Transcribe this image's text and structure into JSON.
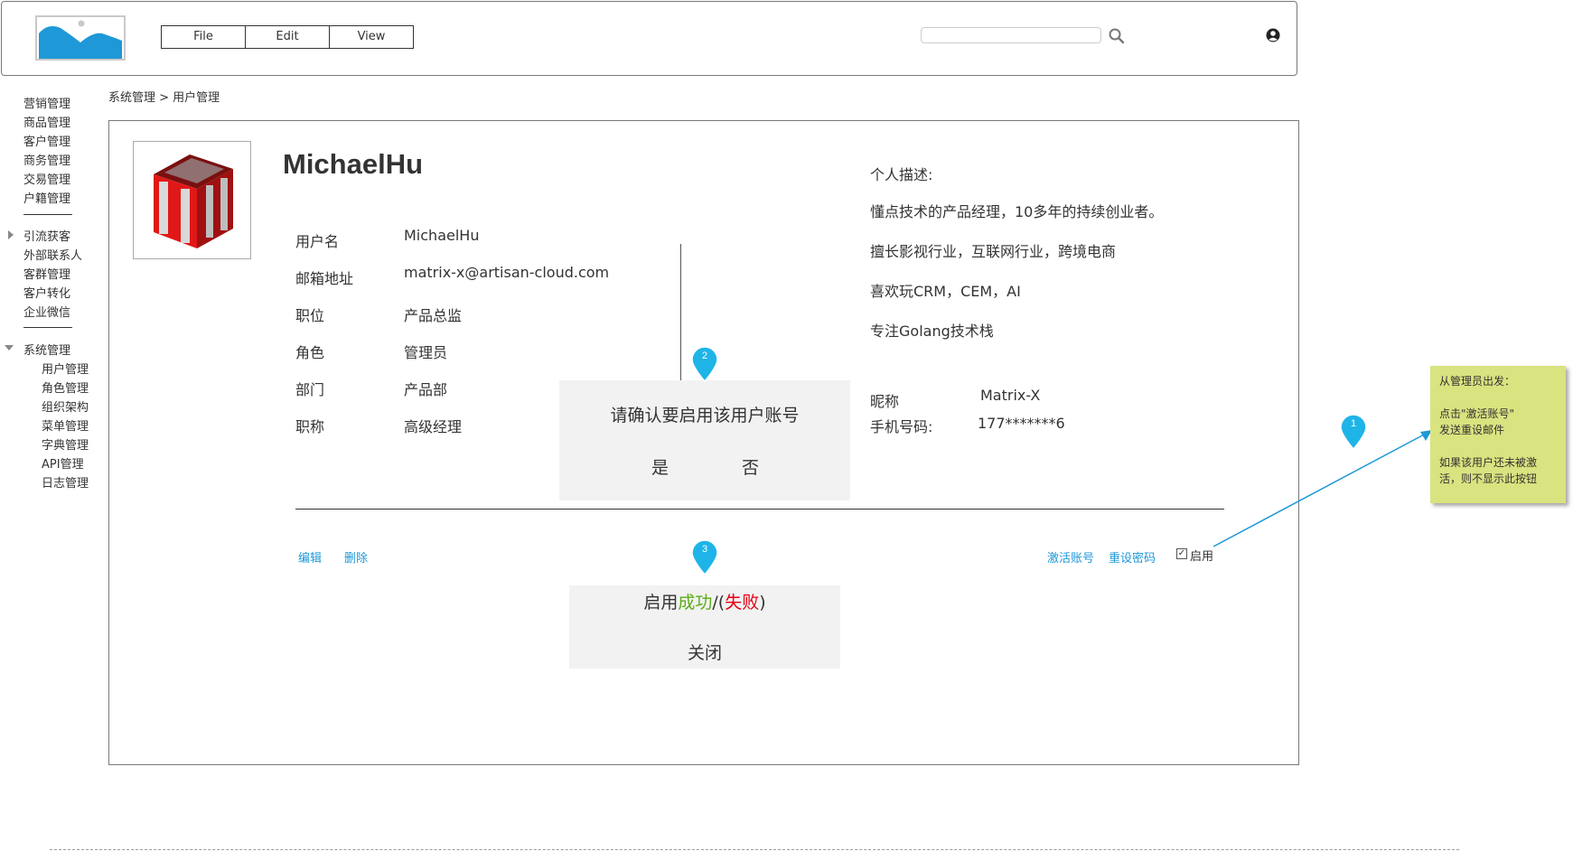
{
  "header": {
    "menu": [
      "File",
      "Edit",
      "View"
    ],
    "search": {
      "value": "",
      "placeholder": ""
    }
  },
  "sidebar": {
    "group1": [
      "营销管理",
      "商品管理",
      "客户管理",
      "商务管理",
      "交易管理",
      "户籍管理"
    ],
    "group2_title": "引流获客",
    "group2": [
      "外部联系人",
      "客群管理",
      "客户转化",
      "企业微信"
    ],
    "group3_title": "系统管理",
    "group3": [
      "用户管理",
      "角色管理",
      "组织架构",
      "菜单管理",
      "字典管理",
      "API管理",
      "日志管理"
    ]
  },
  "breadcrumb": "系统管理 > 用户管理",
  "profile": {
    "name": "MichaelHu",
    "fields": [
      {
        "label": "用户名",
        "value": "MichaelHu"
      },
      {
        "label": "邮箱地址",
        "value": "matrix-x@artisan-cloud.com"
      },
      {
        "label": "职位",
        "value": "产品总监"
      },
      {
        "label": "角色",
        "value": "管理员"
      },
      {
        "label": "部门",
        "value": "产品部"
      },
      {
        "label": "职称",
        "value": "高级经理"
      }
    ],
    "description_title": "个人描述:",
    "description": [
      "懂点技术的产品经理，10多年的持续创业者。",
      "擅长影视行业，互联网行业，跨境电商",
      "喜欢玩CRM，CEM，AI",
      "专注Golang技术栈"
    ],
    "nickname_label": "昵称",
    "nickname_value": "Matrix-X",
    "phone_label": "手机号码:",
    "phone_value": "177*******6"
  },
  "actions": {
    "edit": "编辑",
    "delete": "删除",
    "activate": "激活账号",
    "reset_password": "重设密码",
    "enable": "启用",
    "enable_checked": true
  },
  "confirm_dialog": {
    "text": "请确认要启用该用户账号",
    "yes": "是",
    "no": "否"
  },
  "result_dialog": {
    "prefix": "启用",
    "success": "成功",
    "middle": "/(",
    "failure": "失败",
    "suffix": ")",
    "close": "关闭",
    "success_color": "#5cad17",
    "failure_color": "#e60012"
  },
  "markers": [
    "1",
    "2",
    "3"
  ],
  "note": {
    "line1": "从管理员出发：",
    "line2": "点击\"激活账号\"",
    "line3": "发送重设邮件",
    "line4": "如果该用户还未被激",
    "line5": "活，则不显示此按钮"
  },
  "colors": {
    "link": "#1e98d7",
    "marker": "#1fb4e8",
    "note": "#d9e37f"
  }
}
